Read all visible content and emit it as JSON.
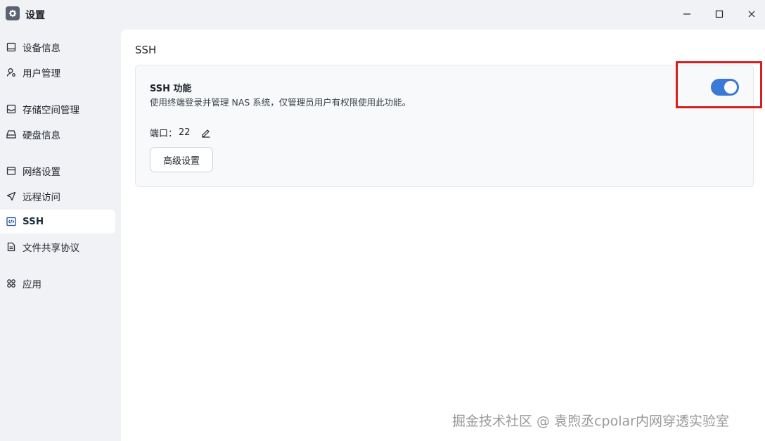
{
  "window": {
    "title": "设置",
    "icon": "gear-icon",
    "controls": {
      "minimize": "minimize-icon",
      "maximize": "maximize-icon",
      "close": "close-icon"
    }
  },
  "sidebar": {
    "items": [
      {
        "label": "设备信息",
        "icon": "device-info-icon",
        "active": false
      },
      {
        "label": "用户管理",
        "icon": "user-manage-icon",
        "active": false
      },
      {
        "label": "存储空间管理",
        "icon": "storage-icon",
        "active": false
      },
      {
        "label": "硬盘信息",
        "icon": "disk-icon",
        "active": false
      },
      {
        "label": "网络设置",
        "icon": "network-icon",
        "active": false
      },
      {
        "label": "远程访问",
        "icon": "remote-access-icon",
        "active": false
      },
      {
        "label": "SSH",
        "icon": "code-icon",
        "active": true
      },
      {
        "label": "文件共享协议",
        "icon": "file-share-icon",
        "active": false
      },
      {
        "label": "应用",
        "icon": "apps-icon",
        "active": false
      }
    ]
  },
  "main": {
    "page_title": "SSH",
    "ssh_card": {
      "title": "SSH 功能",
      "description": "使用终端登录并管理 NAS 系统，仅管理员用户有权限使用此功能。",
      "port_label": "端口：",
      "port_value": "22",
      "advanced_button": "高级设置",
      "toggle_on": true
    }
  },
  "colors": {
    "accent": "#3a79d6",
    "highlight_box": "#d42020",
    "sidebar_bg": "#f0f2f5",
    "content_bg": "#ffffff"
  },
  "watermark": "掘金技术社区 @ 袁煦丞cpolar内网穿透实验室"
}
